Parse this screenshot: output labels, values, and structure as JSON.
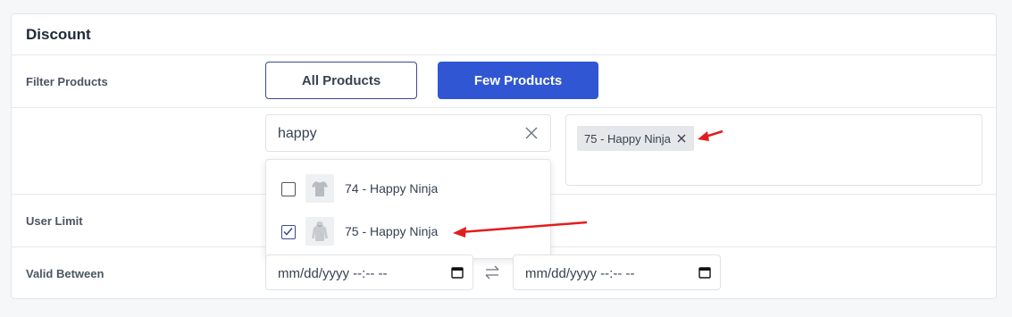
{
  "panel": {
    "title": "Discount"
  },
  "rows": {
    "filter_products": "Filter Products",
    "user_limit": "User Limit",
    "valid_between": "Valid Between"
  },
  "filter_buttons": {
    "all": "All Products",
    "few": "Few Products"
  },
  "search": {
    "value": "happy"
  },
  "selected_tags": [
    {
      "label": "75 - Happy Ninja"
    }
  ],
  "dropdown_options": [
    {
      "label": "74 - Happy Ninja",
      "checked": false,
      "icon": "tshirt-icon"
    },
    {
      "label": "75 - Happy Ninja",
      "checked": true,
      "icon": "hoodie-icon"
    }
  ],
  "valid_between": {
    "start_placeholder": "mm/dd/yyyy --:-- --",
    "end_placeholder": "mm/dd/yyyy --:-- --"
  },
  "colors": {
    "primary": "#3056d3",
    "outline_border": "#3b4a8f",
    "annotation_arrow": "#e11d1d"
  }
}
